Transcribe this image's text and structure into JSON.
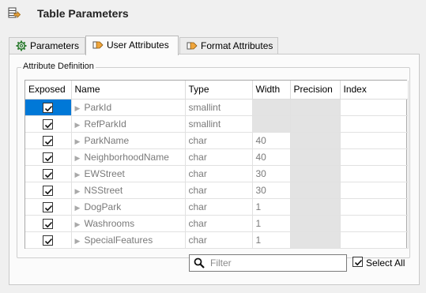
{
  "header": {
    "title": "Table Parameters",
    "icon": "table-parameters-icon"
  },
  "tabs": [
    {
      "label": "Parameters",
      "icon": "gear-icon",
      "active": false
    },
    {
      "label": "User Attributes",
      "icon": "arrow-right-icon",
      "active": true
    },
    {
      "label": "Format Attributes",
      "icon": "arrow-right-icon",
      "active": false
    }
  ],
  "group": {
    "label": "Attribute Definition"
  },
  "grid": {
    "columns": [
      "Exposed",
      "Name",
      "Type",
      "Width",
      "Precision",
      "Index"
    ],
    "rows": [
      {
        "exposed": true,
        "name": "ParkId",
        "type": "smallint",
        "width": "",
        "precision": "",
        "index": ""
      },
      {
        "exposed": true,
        "name": "RefParkId",
        "type": "smallint",
        "width": "",
        "precision": "",
        "index": ""
      },
      {
        "exposed": true,
        "name": "ParkName",
        "type": "char",
        "width": "40",
        "precision": "",
        "index": ""
      },
      {
        "exposed": true,
        "name": "NeighborhoodName",
        "type": "char",
        "width": "40",
        "precision": "",
        "index": ""
      },
      {
        "exposed": true,
        "name": "EWStreet",
        "type": "char",
        "width": "30",
        "precision": "",
        "index": ""
      },
      {
        "exposed": true,
        "name": "NSStreet",
        "type": "char",
        "width": "30",
        "precision": "",
        "index": ""
      },
      {
        "exposed": true,
        "name": "DogPark",
        "type": "char",
        "width": "1",
        "precision": "",
        "index": ""
      },
      {
        "exposed": true,
        "name": "Washrooms",
        "type": "char",
        "width": "1",
        "precision": "",
        "index": ""
      },
      {
        "exposed": true,
        "name": "SpecialFeatures",
        "type": "char",
        "width": "1",
        "precision": "",
        "index": ""
      }
    ]
  },
  "filter": {
    "placeholder": "Filter",
    "value": ""
  },
  "select_all": {
    "label": "Select All",
    "checked": true
  }
}
